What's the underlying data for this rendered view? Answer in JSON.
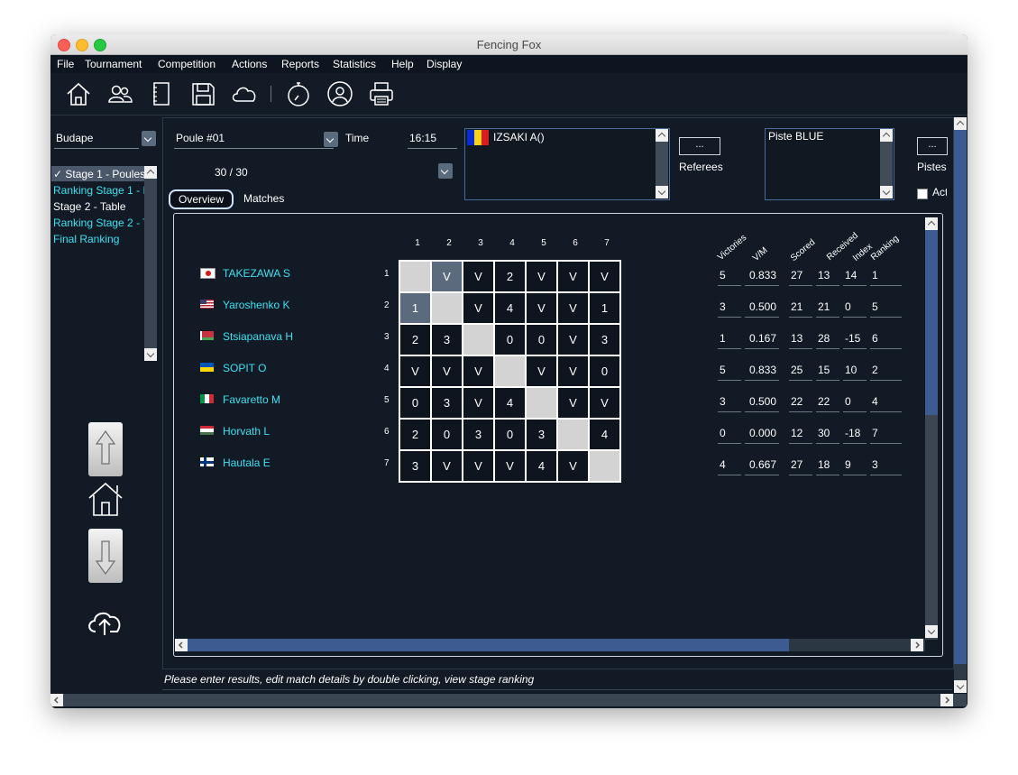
{
  "window": {
    "title": "Fencing Fox"
  },
  "menu": [
    "File",
    "Tournament",
    "Competition",
    "Actions",
    "Reports",
    "Statistics",
    "Help",
    "Display"
  ],
  "toolbar_icons": [
    "home-icon",
    "users-icon",
    "notebook-icon",
    "save-icon",
    "cloud-icon",
    "stopwatch-icon",
    "user-circle-icon",
    "printer-icon"
  ],
  "left": {
    "competition_select": "Budape",
    "stages": [
      {
        "label": "Stage 1 - Poules",
        "selected": true
      },
      {
        "label": "Ranking Stage 1 - I"
      },
      {
        "label": "Stage 2 - Table"
      },
      {
        "label": "Ranking Stage 2 - T"
      },
      {
        "label": "Final Ranking"
      }
    ]
  },
  "poule": {
    "select": "Poule #01",
    "time_label": "Time",
    "time_value": "16:15",
    "count": "30 / 30",
    "referee": "IZSAKI A()",
    "referees_button": "...",
    "referees_label": "Referees",
    "piste": "Piste BLUE",
    "pistes_button": "...",
    "pistes_label": "Pistes",
    "active_label": "Act"
  },
  "tabs": {
    "overview": "Overview",
    "matches": "Matches"
  },
  "columns": [
    "1",
    "2",
    "3",
    "4",
    "5",
    "6",
    "7"
  ],
  "fencers": [
    {
      "num": "1",
      "name": "TAKEZAWA S",
      "flag": "japan",
      "results": [
        "",
        "V",
        "V",
        "2",
        "V",
        "V",
        "V"
      ],
      "stats": [
        "5",
        "0.833",
        "27",
        "13",
        "14",
        "1"
      ]
    },
    {
      "num": "2",
      "name": "Yaroshenko K",
      "flag": "usa",
      "results": [
        "1",
        "",
        "V",
        "4",
        "V",
        "V",
        "1"
      ],
      "stats": [
        "3",
        "0.500",
        "21",
        "21",
        "0",
        "5"
      ]
    },
    {
      "num": "3",
      "name": "Stsiapanava H",
      "flag": "belarus",
      "results": [
        "2",
        "3",
        "",
        "0",
        "0",
        "V",
        "3"
      ],
      "stats": [
        "1",
        "0.167",
        "13",
        "28",
        "-15",
        "6"
      ]
    },
    {
      "num": "4",
      "name": "SOPIT O",
      "flag": "ukraine",
      "results": [
        "V",
        "V",
        "V",
        "",
        "V",
        "V",
        "0"
      ],
      "stats": [
        "5",
        "0.833",
        "25",
        "15",
        "10",
        "2"
      ]
    },
    {
      "num": "5",
      "name": "Favaretto M",
      "flag": "italy",
      "results": [
        "0",
        "3",
        "V",
        "4",
        "",
        "V",
        "V"
      ],
      "stats": [
        "3",
        "0.500",
        "22",
        "22",
        "0",
        "4"
      ]
    },
    {
      "num": "6",
      "name": "Horvath L",
      "flag": "hungary",
      "results": [
        "2",
        "0",
        "3",
        "0",
        "3",
        "",
        "4"
      ],
      "stats": [
        "0",
        "0.000",
        "12",
        "30",
        "-18",
        "7"
      ]
    },
    {
      "num": "7",
      "name": "Hautala E",
      "flag": "finland",
      "results": [
        "3",
        "V",
        "V",
        "V",
        "4",
        "V",
        ""
      ],
      "stats": [
        "4",
        "0.667",
        "27",
        "18",
        "9",
        "3"
      ]
    }
  ],
  "stat_headers": [
    "Victories",
    "V/M",
    "Scored",
    "Received",
    "Index",
    "Ranking"
  ],
  "status": "Please enter results, edit match details by double clicking, view stage ranking"
}
